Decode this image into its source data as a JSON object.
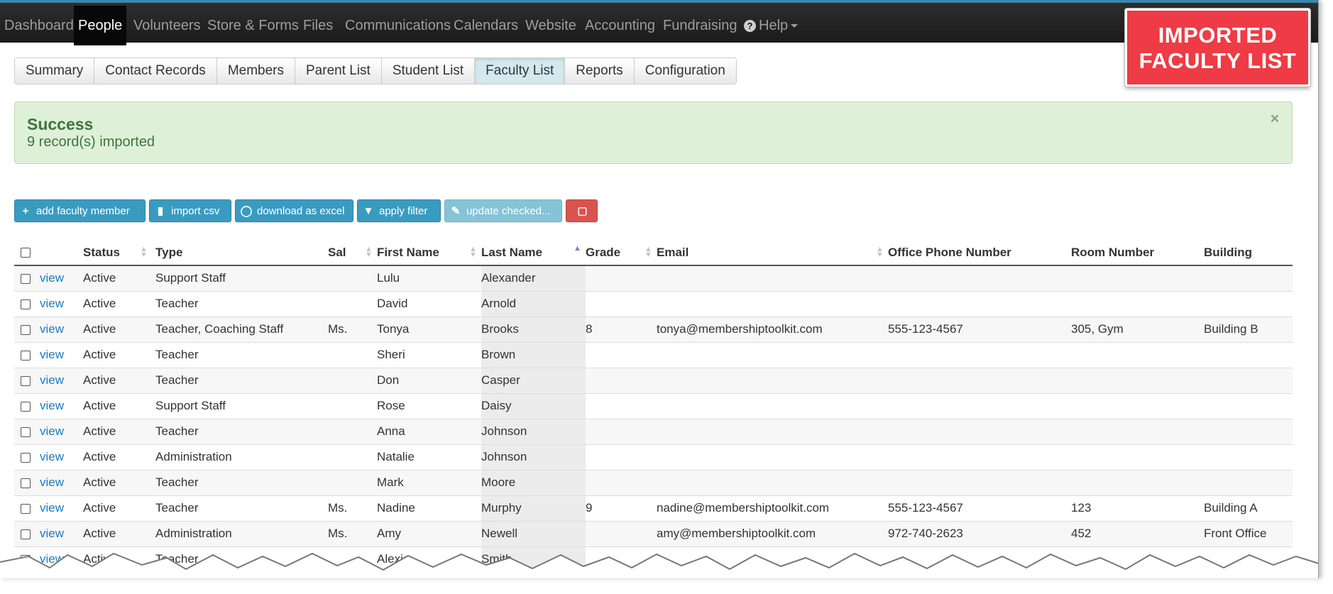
{
  "nav": {
    "items": [
      "Dashboard",
      "People",
      "Volunteers",
      "Store & Forms",
      "Files",
      "Communications",
      "Calendars",
      "Website",
      "Accounting",
      "Fundraising"
    ],
    "active": "People",
    "help_label": "Help"
  },
  "subnav": {
    "tabs": [
      "Summary",
      "Contact Records",
      "Members",
      "Parent List",
      "Student List",
      "Faculty List",
      "Reports",
      "Configuration"
    ],
    "active": "Faculty List"
  },
  "badge": {
    "line1": "IMPORTED",
    "line2": "FACULTY LIST",
    "color": "#ee3b45"
  },
  "alert": {
    "title": "Success",
    "message": "9 record(s) imported",
    "close": "×"
  },
  "toolbar": {
    "add": "add faculty member",
    "import": "import csv",
    "download": "download as excel",
    "filter": "apply filter",
    "update": "update checked..."
  },
  "table": {
    "columns": [
      "Status",
      "Type",
      "Sal",
      "First Name",
      "Last Name",
      "Grade",
      "Email",
      "Office Phone Number",
      "Room Number",
      "Building"
    ],
    "sorted_column": "Last Name",
    "row_link": "view",
    "rows": [
      {
        "status": "Active",
        "type": "Support Staff",
        "sal": "",
        "first": "Lulu",
        "last": "Alexander",
        "grade": "",
        "email": "",
        "phone": "",
        "room": "",
        "building": ""
      },
      {
        "status": "Active",
        "type": "Teacher",
        "sal": "",
        "first": "David",
        "last": "Arnold",
        "grade": "",
        "email": "",
        "phone": "",
        "room": "",
        "building": ""
      },
      {
        "status": "Active",
        "type": "Teacher, Coaching Staff",
        "sal": "Ms.",
        "first": "Tonya",
        "last": "Brooks",
        "grade": "8",
        "email": "tonya@membershiptoolkit.com",
        "phone": "555-123-4567",
        "room": "305, Gym",
        "building": "Building B"
      },
      {
        "status": "Active",
        "type": "Teacher",
        "sal": "",
        "first": "Sheri",
        "last": "Brown",
        "grade": "",
        "email": "",
        "phone": "",
        "room": "",
        "building": ""
      },
      {
        "status": "Active",
        "type": "Teacher",
        "sal": "",
        "first": "Don",
        "last": "Casper",
        "grade": "",
        "email": "",
        "phone": "",
        "room": "",
        "building": ""
      },
      {
        "status": "Active",
        "type": "Support Staff",
        "sal": "",
        "first": "Rose",
        "last": "Daisy",
        "grade": "",
        "email": "",
        "phone": "",
        "room": "",
        "building": ""
      },
      {
        "status": "Active",
        "type": "Teacher",
        "sal": "",
        "first": "Anna",
        "last": "Johnson",
        "grade": "",
        "email": "",
        "phone": "",
        "room": "",
        "building": ""
      },
      {
        "status": "Active",
        "type": "Administration",
        "sal": "",
        "first": "Natalie",
        "last": "Johnson",
        "grade": "",
        "email": "",
        "phone": "",
        "room": "",
        "building": ""
      },
      {
        "status": "Active",
        "type": "Teacher",
        "sal": "",
        "first": "Mark",
        "last": "Moore",
        "grade": "",
        "email": "",
        "phone": "",
        "room": "",
        "building": ""
      },
      {
        "status": "Active",
        "type": "Teacher",
        "sal": "Ms.",
        "first": "Nadine",
        "last": "Murphy",
        "grade": "9",
        "email": "nadine@membershiptoolkit.com",
        "phone": "555-123-4567",
        "room": "123",
        "building": "Building A"
      },
      {
        "status": "Active",
        "type": "Administration",
        "sal": "Ms.",
        "first": "Amy",
        "last": "Newell",
        "grade": "",
        "email": "amy@membershiptoolkit.com",
        "phone": "972-740-2623",
        "room": "452",
        "building": "Front Office"
      },
      {
        "status": "Active",
        "type": "Teacher",
        "sal": "",
        "first": "Alexis",
        "last": "Smith",
        "grade": "",
        "email": "",
        "phone": "",
        "room": "",
        "building": ""
      }
    ]
  }
}
